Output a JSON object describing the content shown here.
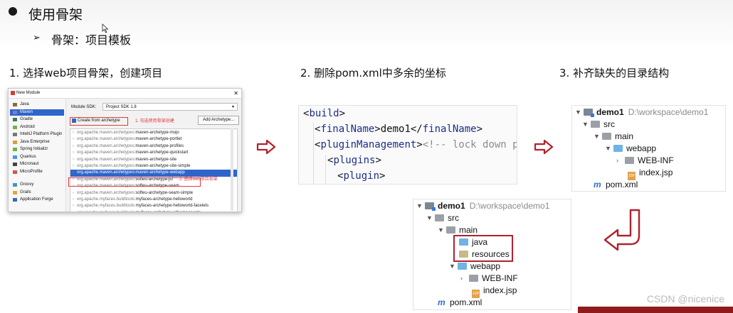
{
  "header": {
    "bullet_title": "使用骨架",
    "sub_marker": "➢",
    "sub_text": "骨架：项目模板"
  },
  "steps": {
    "step1": "1. 选择web项目骨架，创建项目",
    "step2": "2. 删除pom.xml中多余的坐标",
    "step3": "3. 补齐缺失的目录结构"
  },
  "dialog": {
    "title": "New Module",
    "sidebar": [
      {
        "label": "Java",
        "color": "#8c6a3c"
      },
      {
        "label": "Maven",
        "color": "#7b7bd0",
        "selected": true
      },
      {
        "label": "Gradle",
        "color": "#3b7a57"
      },
      {
        "label": "Android",
        "color": "#6fb24a"
      },
      {
        "label": "IntelliJ Platform Plugin",
        "color": "#777777"
      },
      {
        "label": "Java Enterprise",
        "color": "#e09a3c"
      },
      {
        "label": "Spring Initializr",
        "color": "#6db33f"
      },
      {
        "label": "Quarkus",
        "color": "#4695eb"
      },
      {
        "label": "Micronaut",
        "color": "#444444"
      },
      {
        "label": "MicroProfile",
        "color": "#d9534f"
      },
      {
        "label": "Groovy",
        "color": "#4298b8"
      },
      {
        "label": "Grails",
        "color": "#e8a33d"
      },
      {
        "label": "Application Forge",
        "color": "#2d6db5"
      }
    ],
    "sdk_label": "Module SDK:",
    "sdk_value": "Project SDK 1.8",
    "create_from_archetype": "Create from archetype",
    "annotation_1": "1. 勾选使用骨架创建",
    "add_archetype": "Add Archetype...",
    "archetypes": [
      {
        "prefix": "org.apache.maven.archetypes:",
        "name": "maven-archetype-mojo"
      },
      {
        "prefix": "org.apache.maven.archetypes:",
        "name": "maven-archetype-portlet"
      },
      {
        "prefix": "org.apache.maven.archetypes:",
        "name": "maven-archetype-profiles"
      },
      {
        "prefix": "org.apache.maven.archetypes:",
        "name": "maven-archetype-quickstart"
      },
      {
        "prefix": "org.apache.maven.archetypes:",
        "name": "maven-archetype-site"
      },
      {
        "prefix": "org.apache.maven.archetypes:",
        "name": "maven-archetype-site-simple"
      },
      {
        "prefix": "org.apache.maven.archetypes:",
        "name": "maven-archetype-webapp",
        "selected": true
      },
      {
        "prefix": "org.apache.maven.archetypes:",
        "name": "softeu-archetype-jsf"
      },
      {
        "prefix": "org.apache.maven.archetypes:",
        "name": "softeu-archetype-seam"
      },
      {
        "prefix": "org.apache.maven.archetypes:",
        "name": "softeu-archetype-seam-simple"
      },
      {
        "prefix": "org.apache.myfaces.buildtools:",
        "name": "myfaces-archetype-helloworld"
      },
      {
        "prefix": "org.apache.myfaces.buildtools:",
        "name": "myfaces-archetype-helloworld-facelets"
      },
      {
        "prefix": "org.apache.myfaces.buildtools:",
        "name": "myfaces-archetype-jsfcomponents"
      }
    ],
    "annotation_2": "2. 选择web项目骨架"
  },
  "code": {
    "line1_open": "<",
    "line1_tag": "build",
    "line1_close": ">",
    "line2_open": "<",
    "line2_tag": "finalName",
    "line2_mid": ">demo1</",
    "line2_tag2": "finalName",
    "line2_close": ">",
    "line3_open": "<",
    "line3_tag": "pluginManagement",
    "line3_close": ">",
    "line3_comment": "<!-- lock down pl",
    "line4_open": "<",
    "line4_tag": "plugins",
    "line4_close": ">",
    "line5_open": "<",
    "line5_tag": "plugin",
    "line5_close": ">"
  },
  "tree_before": {
    "root_name": "demo1",
    "root_path": "D:\\workspace\\demo1",
    "src": "src",
    "main": "main",
    "webapp": "webapp",
    "web_inf": "WEB-INF",
    "index_jsp": "index.jsp",
    "pom": "pom.xml"
  },
  "tree_after": {
    "root_name": "demo1",
    "root_path": "D:\\workspace\\demo1",
    "src": "src",
    "main": "main",
    "java": "java",
    "resources": "resources",
    "webapp": "webapp",
    "web_inf": "WEB-INF",
    "index_jsp": "index.jsp",
    "pom": "pom.xml"
  },
  "icons": {
    "jsp_badge": "JSP",
    "maven_badge": "m"
  },
  "watermark": "CSDN @nicenice",
  "colors": {
    "accent_red": "#b0222e",
    "selection_blue": "#2f65ca",
    "tag_blue": "#1c2f8a"
  }
}
